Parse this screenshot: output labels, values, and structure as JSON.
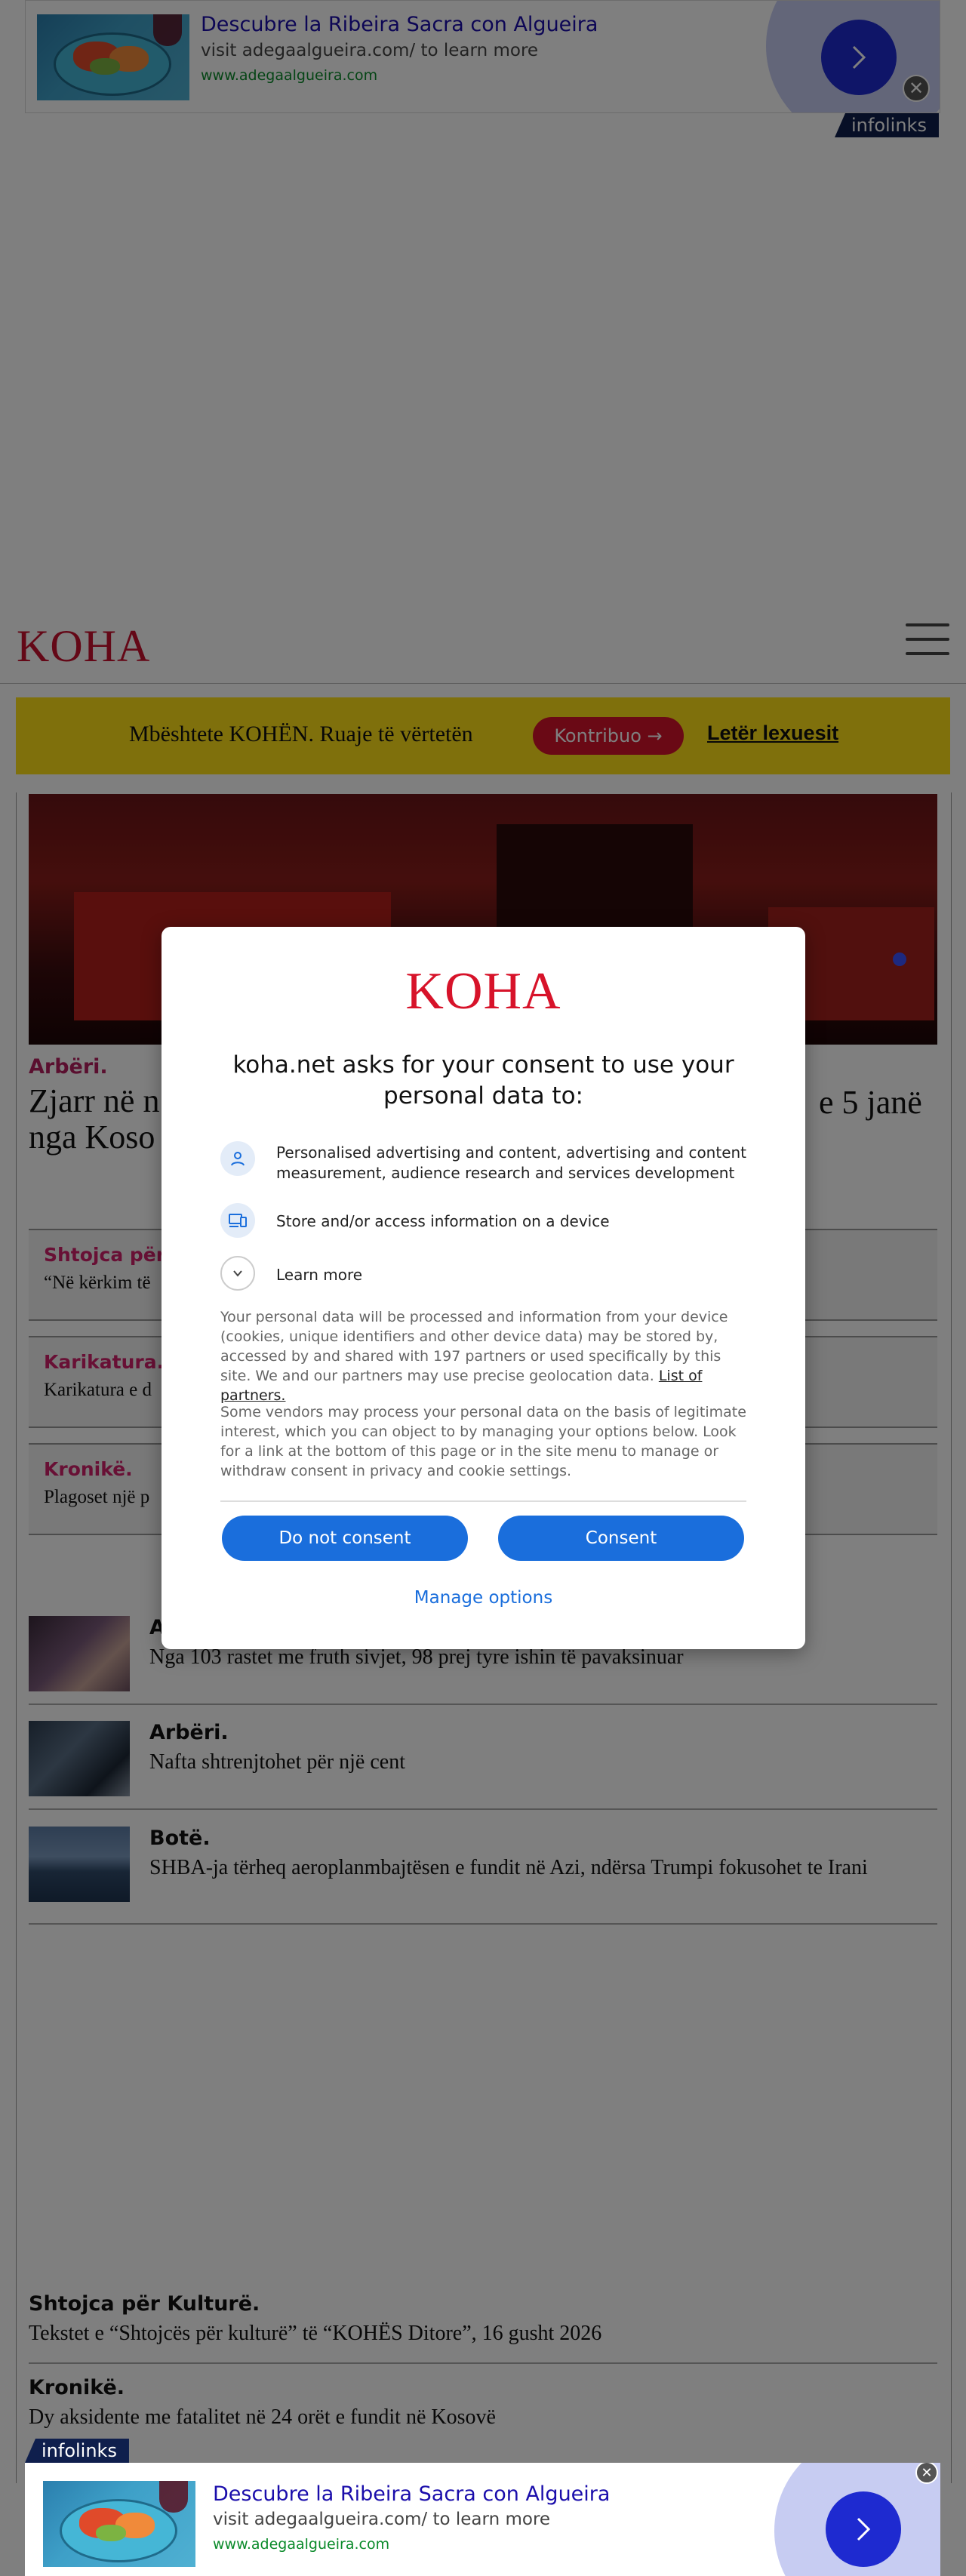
{
  "top_ad": {
    "title": "Descubre la Ribeira Sacra con Algueira",
    "line": "visit adegaalgueira.com/ to learn more",
    "url": "www.adegaalgueira.com",
    "close_glyph": "✕",
    "badge": "infolinks"
  },
  "header": {
    "logo": "KOHA",
    "menu_icon": "hamburger-icon"
  },
  "support": {
    "text": "Mbështete KOHËN. Ruaje të vërtetën",
    "button": "Kontribuo →",
    "link": "Letër lexuesit"
  },
  "hero": {
    "kicker": "Arbëri.",
    "title_left": "Zjarr në n",
    "title_left2": "nga Koso",
    "title_right": "e 5 janë"
  },
  "cards": [
    {
      "kicker": "Shtojca për k",
      "text": "“Në kërkim të"
    },
    {
      "kicker": "Karikatura.",
      "text": "Karikatura e d"
    },
    {
      "kicker": "Kronikë.",
      "text": "Plagoset një p"
    }
  ],
  "news": [
    {
      "kicker": "A",
      "text": "Nga 103 rastet me fruth sivjet, 98 prej tyre ishin të pavaksinuar"
    },
    {
      "kicker": "Arbëri.",
      "text": "Nafta shtrenjtohet për një cent"
    },
    {
      "kicker": "Botë.",
      "text": "SHBA-ja tërheq aeroplanmbajtësen e fundit në Azi, ndërsa Trumpi fokusohet te Irani"
    }
  ],
  "bottom": [
    {
      "kicker": "Shtojca për Kulturë.",
      "text": "Tekstet e “Shtojcës për kulturë” të “KOHËS Ditore”, 16 gusht 2026"
    },
    {
      "kicker": "Kronikë.",
      "text": "Dy aksidente me fatalitet në 24 orët e fundit në Kosovë"
    }
  ],
  "consent": {
    "logo": "KOHA",
    "title": "koha.net asks for your consent to use your personal data to:",
    "purposes": [
      {
        "icon": "person-icon",
        "text": "Personalised advertising and content, advertising and content measurement, audience research and services development"
      },
      {
        "icon": "devices-icon",
        "text": "Store and/or access information on a device"
      }
    ],
    "learn_more": "Learn more",
    "para1": "Your personal data will be processed and information from your device (cookies, unique identifiers and other device data) may be stored by, accessed by and shared with 197 partners or used specifically by this site. We and our partners may use precise geolocation data.",
    "partners_link": "List of partners.",
    "para2": "Some vendors may process your personal data on the basis of legitimate interest, which you can object to by managing your options below. Look for a link at the bottom of this page or in the site menu to manage or withdraw consent in privacy and cookie settings.",
    "do_not_consent": "Do not consent",
    "consent": "Consent",
    "manage_options": "Manage options",
    "accent": "#1a6edc"
  },
  "bottom_ad": {
    "title": "Descubre la Ribeira Sacra con Algueira",
    "line": "visit adegaalgueira.com/ to learn more",
    "url": "www.adegaalgueira.com",
    "close_glyph": "✕",
    "badge": "infolinks"
  }
}
